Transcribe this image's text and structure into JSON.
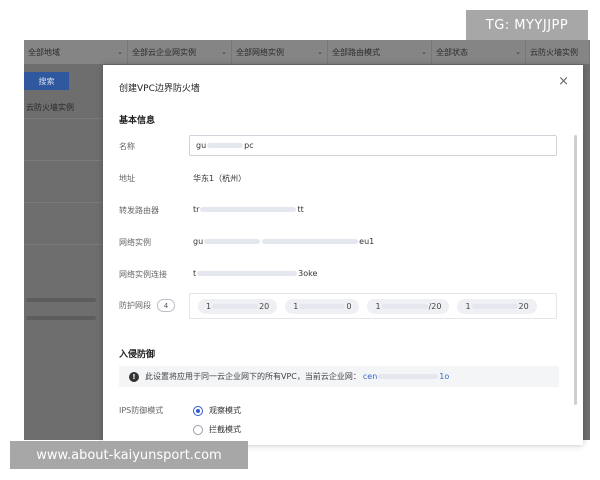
{
  "watermarks": {
    "top": "TG: MYYJJPP",
    "bottom": "www.about-kaiyunsport.com"
  },
  "background": {
    "filters": [
      "全部地域",
      "全部云企业网实例",
      "全部网络实例",
      "全部路由模式",
      "全部状态",
      "云防火墙实例"
    ],
    "button_label": "搜索",
    "column_label": "云防火墙实例"
  },
  "modal": {
    "title": "创建VPC边界防火墙",
    "close_icon": "×",
    "basic_section": "基本信息",
    "name_label": "名称",
    "name_value_start": "gu",
    "name_value_end": "pc",
    "region_label": "地址",
    "region_value": "华东1（杭州）",
    "router_label": "转发路由器",
    "router_value_start": "tr",
    "router_value_end": "tt",
    "network_instance_label": "网络实例",
    "network_instance_start": "gu",
    "network_instance_end": "eu1",
    "network_conn_label": "网络实例连接",
    "network_conn_start": "t",
    "network_conn_end": "3oke",
    "cidr_label": "防护网段",
    "cidr_count": "4",
    "cidrs": [
      {
        "start": "1",
        "end": "20"
      },
      {
        "start": "1",
        "end": "0"
      },
      {
        "start": "1",
        "end": "/20"
      },
      {
        "start": "1",
        "end": "20"
      }
    ],
    "ips_section": "入侵防御",
    "info_text": "此设置将应用于同一云企业网下的所有VPC，当前云企业网：",
    "info_link_start": "cen",
    "info_link_end": "1o",
    "ips_mode_label": "IPS防御模式",
    "radio_observe": "观察模式",
    "radio_block": "拦截模式",
    "selected_mode": "observe"
  }
}
